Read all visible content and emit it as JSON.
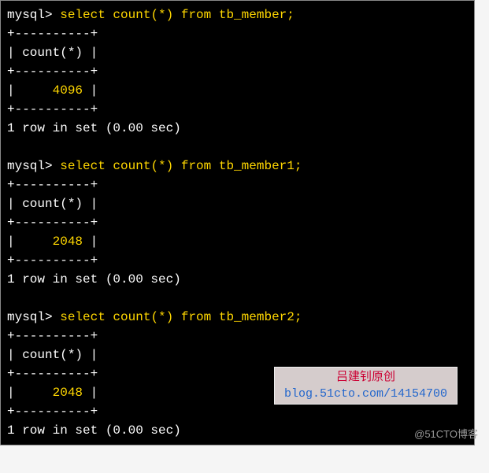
{
  "blocks": [
    {
      "prompt": "mysql> ",
      "query": "select count(*) from tb_member;",
      "border_top": "+----------+",
      "header": "| count(*) |",
      "border_mid": "+----------+",
      "value_line_pre": "|     ",
      "value": "4096",
      "value_line_post": " |",
      "border_bot": "+----------+",
      "status": "1 row in set (0.00 sec)"
    },
    {
      "prompt": "mysql> ",
      "query": "select count(*) from tb_member1;",
      "border_top": "+----------+",
      "header": "| count(*) |",
      "border_mid": "+----------+",
      "value_line_pre": "|     ",
      "value": "2048",
      "value_line_post": " |",
      "border_bot": "+----------+",
      "status": "1 row in set (0.00 sec)"
    },
    {
      "prompt": "mysql> ",
      "query": "select count(*) from tb_member2;",
      "border_top": "+----------+",
      "header": "| count(*) |",
      "border_mid": "+----------+",
      "value_line_pre": "|     ",
      "value": "2048",
      "value_line_post": " |",
      "border_bot": "+----------+",
      "status": "1 row in set (0.00 sec)"
    }
  ],
  "watermark": {
    "title": "吕建钊原创",
    "url": "blog.51cto.com/14154700"
  },
  "footer": "@51CTO博客"
}
